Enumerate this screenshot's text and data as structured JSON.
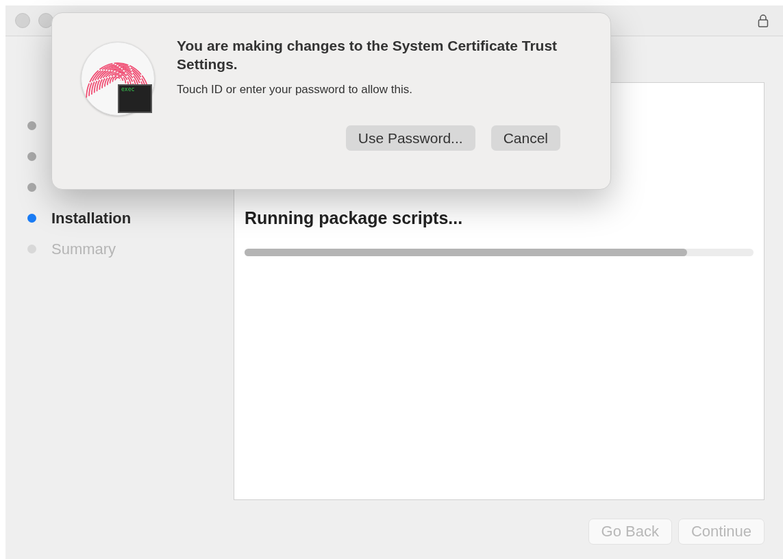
{
  "sidebar": {
    "steps": [
      {
        "completed": true,
        "selected": false
      },
      {
        "completed": true,
        "selected": false
      },
      {
        "completed": true,
        "selected": false
      },
      {
        "label": "Installation",
        "completed": false,
        "selected": true
      },
      {
        "label": "Summary",
        "completed": false,
        "selected": false
      }
    ]
  },
  "content": {
    "heading": "Running package scripts...",
    "progress": {
      "level": 0.87
    }
  },
  "footer": {
    "buttons": [
      {
        "label": "Go Back",
        "disabled": true
      },
      {
        "label": "Continue",
        "disabled": true
      }
    ]
  },
  "dialog": {
    "icon_badge": "exec",
    "title": "You are making changes to the System Certificate Trust Settings.",
    "message": "Touch ID or enter your password to allow this.",
    "buttons": [
      {
        "label": "Use Password..."
      },
      {
        "label": "Cancel"
      }
    ]
  }
}
